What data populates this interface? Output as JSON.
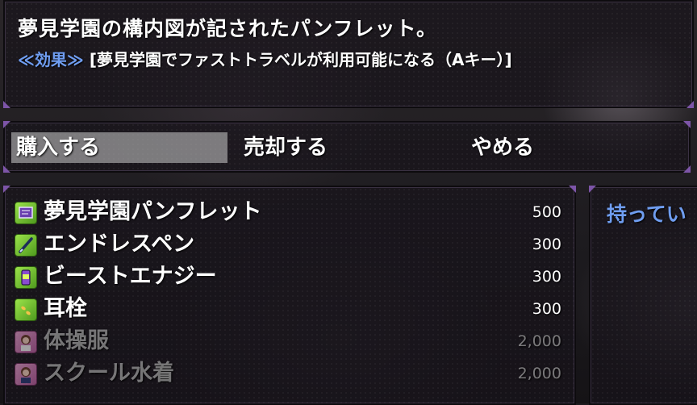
{
  "help": {
    "description": "夢見学園の構内図が記されたパンフレット。",
    "effect_label": "≪効果≫",
    "effect_text": " [夢見学園でファストトラベルが利用可能になる（Aキー）]"
  },
  "commands": [
    {
      "label": "購入する",
      "selected": true
    },
    {
      "label": "売却する",
      "selected": false
    },
    {
      "label": "やめる",
      "selected": false
    }
  ],
  "items": [
    {
      "name": "夢見学園パンフレット",
      "price": "500",
      "icon": "pamphlet-icon",
      "enabled": true
    },
    {
      "name": "エンドレスペン",
      "price": "300",
      "icon": "pen-icon",
      "enabled": true
    },
    {
      "name": "ビーストエナジー",
      "price": "300",
      "icon": "energy-drink-icon",
      "enabled": true
    },
    {
      "name": "耳栓",
      "price": "300",
      "icon": "earplug-icon",
      "enabled": true
    },
    {
      "name": "体操服",
      "price": "2,000",
      "icon": "girl-portrait-icon",
      "enabled": false
    },
    {
      "name": "スクール水着",
      "price": "2,000",
      "icon": "girl-portrait-icon",
      "enabled": false
    }
  ],
  "status": {
    "possession_label": "持ってい"
  },
  "colors": {
    "accent_blue": "#6f9df0",
    "window_corner": "#7d55a8",
    "selection": "#bebebe"
  }
}
